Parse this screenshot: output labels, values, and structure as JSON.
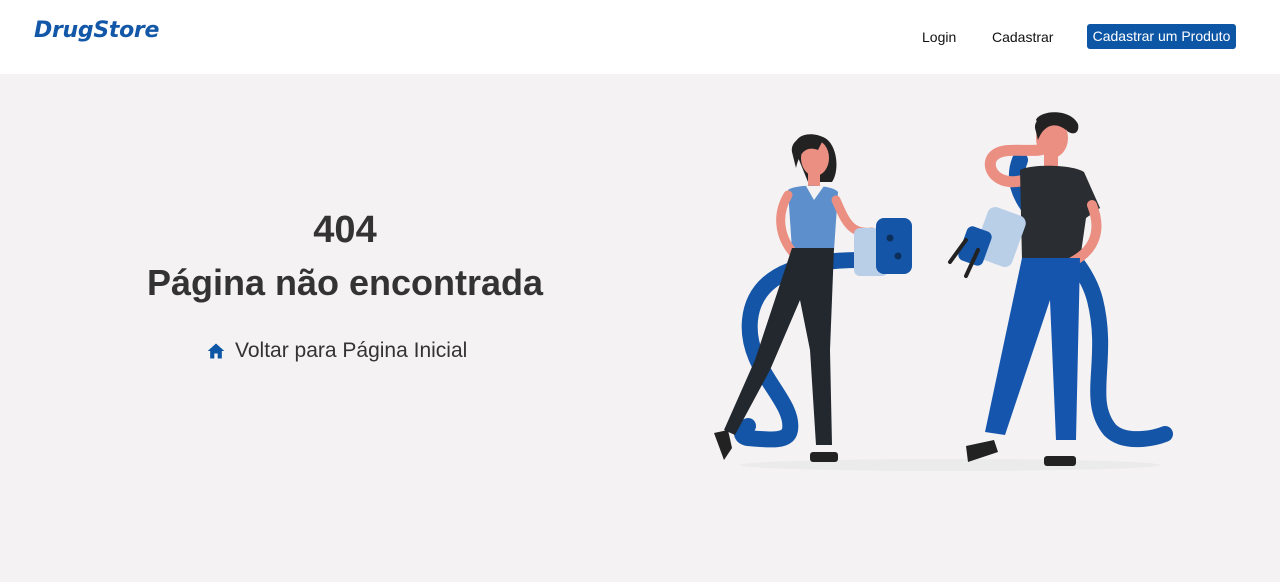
{
  "navbar": {
    "brand": "DrugStore",
    "login_label": "Login",
    "register_label": "Cadastrar",
    "cta_label": "Cadastrar um Produto"
  },
  "error": {
    "code": "404",
    "title": "Página não encontrada",
    "home_link_label": "Voltar para Página Inicial",
    "home_icon": "home-icon"
  },
  "colors": {
    "brand": "#1257a8",
    "cta_background": "#0d56a6",
    "page_background": "#f4f2f3",
    "text": "#333333"
  },
  "illustration": {
    "description_icon": "unplugged-cable-illustration"
  }
}
